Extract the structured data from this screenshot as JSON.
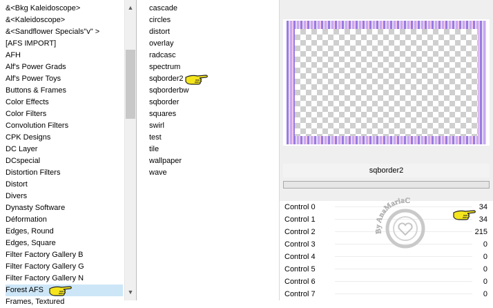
{
  "categories": {
    "items": [
      "&<Bkg Kaleidoscope>",
      "&<Kaleidoscope>",
      "&<Sandflower Specials\"v\" >",
      "[AFS IMPORT]",
      "AFH",
      "Alf's Power Grads",
      "Alf's Power Toys",
      "Buttons & Frames",
      "Color Effects",
      "Color Filters",
      "Convolution Filters",
      "CPK Designs",
      "DC Layer",
      "DCspecial",
      "Distortion Filters",
      "Distort",
      "Divers",
      "Dynasty Software",
      "Déformation",
      "Edges, Round",
      "Edges, Square",
      "Filter Factory Gallery B",
      "Filter Factory Gallery G",
      "Filter Factory Gallery N",
      "Forest AFS",
      "Frames, Textured"
    ],
    "selected_index": 24
  },
  "filters": {
    "items": [
      "cascade",
      "circles",
      "distort",
      "overlay",
      "radcasc",
      "spectrum",
      "sqborder2",
      "sqborderbw",
      "sqborder",
      "squares",
      "swirl",
      "test",
      "tile",
      "wallpaper",
      "wave"
    ],
    "selected_index": 6
  },
  "filter_name": "sqborder2",
  "controls": [
    {
      "label": "Control 0",
      "value": "34"
    },
    {
      "label": "Control 1",
      "value": "34"
    },
    {
      "label": "Control 2",
      "value": "215"
    },
    {
      "label": "Control 3",
      "value": "0"
    },
    {
      "label": "Control 4",
      "value": "0"
    },
    {
      "label": "Control 5",
      "value": "0"
    },
    {
      "label": "Control 6",
      "value": "0"
    },
    {
      "label": "Control 7",
      "value": "0"
    }
  ],
  "watermark": "By AnaMariaC",
  "icons": {
    "pointer": "pointing-hand-icon",
    "scroll_up": "scroll-up-arrow-icon",
    "scroll_down": "scroll-down-arrow-icon"
  },
  "colors": {
    "frame": "#b79ae6",
    "selection": "#cde6f7",
    "hand": "#f5e51c"
  }
}
